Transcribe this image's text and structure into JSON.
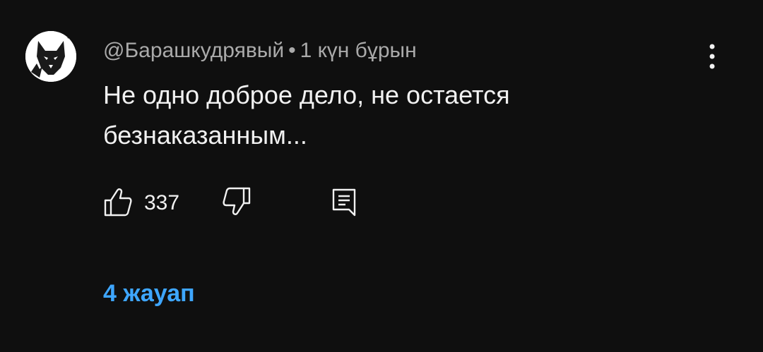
{
  "comment": {
    "author": "@Барашкудрявый",
    "separator": "•",
    "timestamp": "1 күн бұрын",
    "text": "Не одно доброе дело, не остается безнаказанным...",
    "like_count": "337",
    "replies_label": "4 жауап"
  },
  "icons": {
    "avatar": "wolf-avatar-icon",
    "menu": "more-vertical-icon",
    "like": "thumb-up-icon",
    "dislike": "thumb-down-icon",
    "reply": "reply-comment-icon"
  },
  "colors": {
    "background": "#0f0f0f",
    "primary_text": "#f1f1f1",
    "secondary_text": "#aaaaaa",
    "link": "#3ea6ff"
  }
}
